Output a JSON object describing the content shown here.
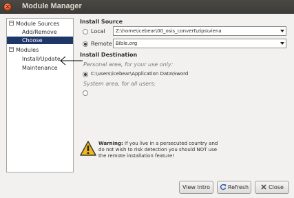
{
  "window": {
    "title": "Module Manager",
    "close_glyph": "×"
  },
  "tree": {
    "expanders": {
      "sources": "−",
      "modules": "−"
    },
    "module_sources": "Module Sources",
    "add_remove": "Add/Remove",
    "choose": "Choose",
    "modules": "Modules",
    "install_update": "Install/Update",
    "maintenance": "Maintenance"
  },
  "install_source": {
    "heading": "Install Source",
    "local_label": "Local",
    "local_value": "Z:\\home\\icebear\\00_osis_convert\\zips\\viena",
    "remote_label": "Remote",
    "remote_value": "Bible.org",
    "selected": "remote"
  },
  "install_destination": {
    "heading": "Install Destination",
    "personal_label": "Personal area, for your use only:",
    "personal_value": "C:\\users\\icebear\\Application Data\\Sword",
    "system_label": "System area, for all users:"
  },
  "warning": {
    "bold": "Warning:",
    "text": " If you live in a persecuted country and do not wish to risk detection you should NOT use the remote installation feature!"
  },
  "buttons": {
    "view_intro": "View Intro",
    "refresh": "Refresh",
    "close": "Close"
  },
  "icons": [
    "close-icon",
    "expander-icon",
    "warning-icon",
    "refresh-icon",
    "close-x-icon"
  ],
  "colors": {
    "selection": "#1f3668",
    "titlebar": "#3c3b37",
    "window_close": "#e1501c"
  }
}
